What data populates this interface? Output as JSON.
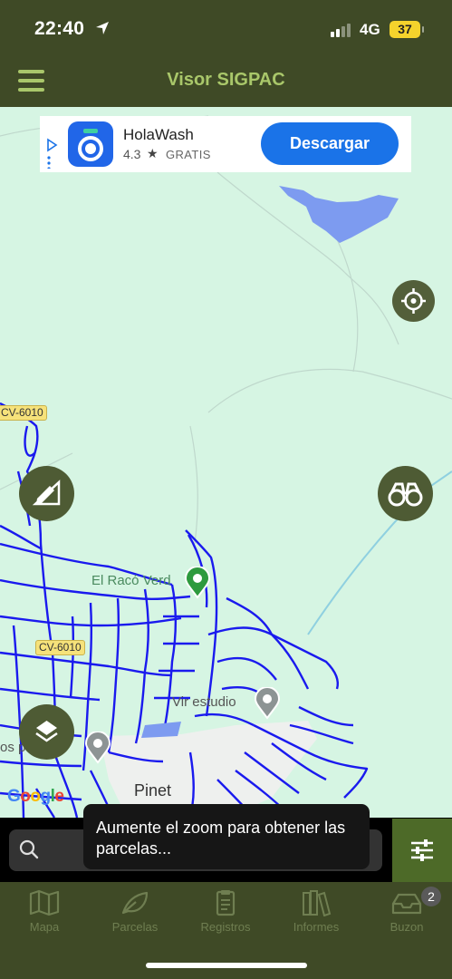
{
  "status_bar": {
    "time": "22:40",
    "network": "4G",
    "battery": "37"
  },
  "app_bar": {
    "title": "Visor SIGPAC"
  },
  "ad": {
    "app_name": "HolaWash",
    "rating": "4.3",
    "price": "GRATIS",
    "cta": "Descargar"
  },
  "map": {
    "road_labels": [
      "CV-6010",
      "CV-6010"
    ],
    "places": [
      "El Racó Verd",
      "Vir estudio",
      "os p"
    ],
    "town": "Pinet",
    "attribution": "Google"
  },
  "search": {
    "placeholder": ""
  },
  "toast": {
    "message": "Aumente el zoom para obtener las parcelas..."
  },
  "tabs": [
    {
      "label": "Mapa",
      "icon": "map-icon"
    },
    {
      "label": "Parcelas",
      "icon": "leaf-icon"
    },
    {
      "label": "Registros",
      "icon": "clipboard-icon"
    },
    {
      "label": "Informes",
      "icon": "books-icon"
    },
    {
      "label": "Buzon",
      "icon": "inbox-icon"
    }
  ],
  "inbox_badge": "2",
  "colors": {
    "bar": "#3f4a26",
    "accent": "#a9c76a",
    "map_bg": "#d6f5e3",
    "parcel_line": "#1a1aff"
  }
}
